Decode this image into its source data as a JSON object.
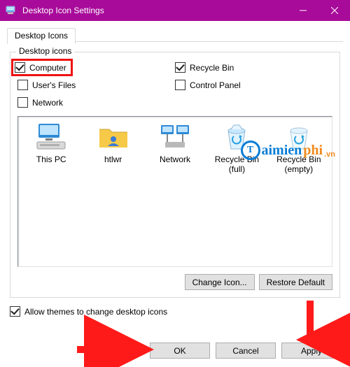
{
  "window": {
    "title": "Desktop Icon Settings"
  },
  "tab": {
    "label": "Desktop Icons"
  },
  "group": {
    "legend": "Desktop icons"
  },
  "checks": {
    "computer": {
      "label": "Computer",
      "checked": true
    },
    "usersfiles": {
      "label": "User's Files",
      "checked": false
    },
    "network": {
      "label": "Network",
      "checked": false
    },
    "recyclebin": {
      "label": "Recycle Bin",
      "checked": true
    },
    "controlpanel": {
      "label": "Control Panel",
      "checked": false
    }
  },
  "watermark": {
    "blue": "aimien",
    "orange": "phi",
    "vn": ".vn"
  },
  "preview": {
    "items": [
      {
        "label": "This PC"
      },
      {
        "label": "htlwr"
      },
      {
        "label": "Network"
      },
      {
        "label": "Recycle Bin (full)"
      },
      {
        "label": "Recycle Bin (empty)"
      }
    ]
  },
  "buttons": {
    "changeicon": "Change Icon...",
    "restore": "Restore Default",
    "ok": "OK",
    "cancel": "Cancel",
    "apply": "Apply"
  },
  "allow_themes": {
    "label": "Allow themes to change desktop icons",
    "checked": true
  }
}
